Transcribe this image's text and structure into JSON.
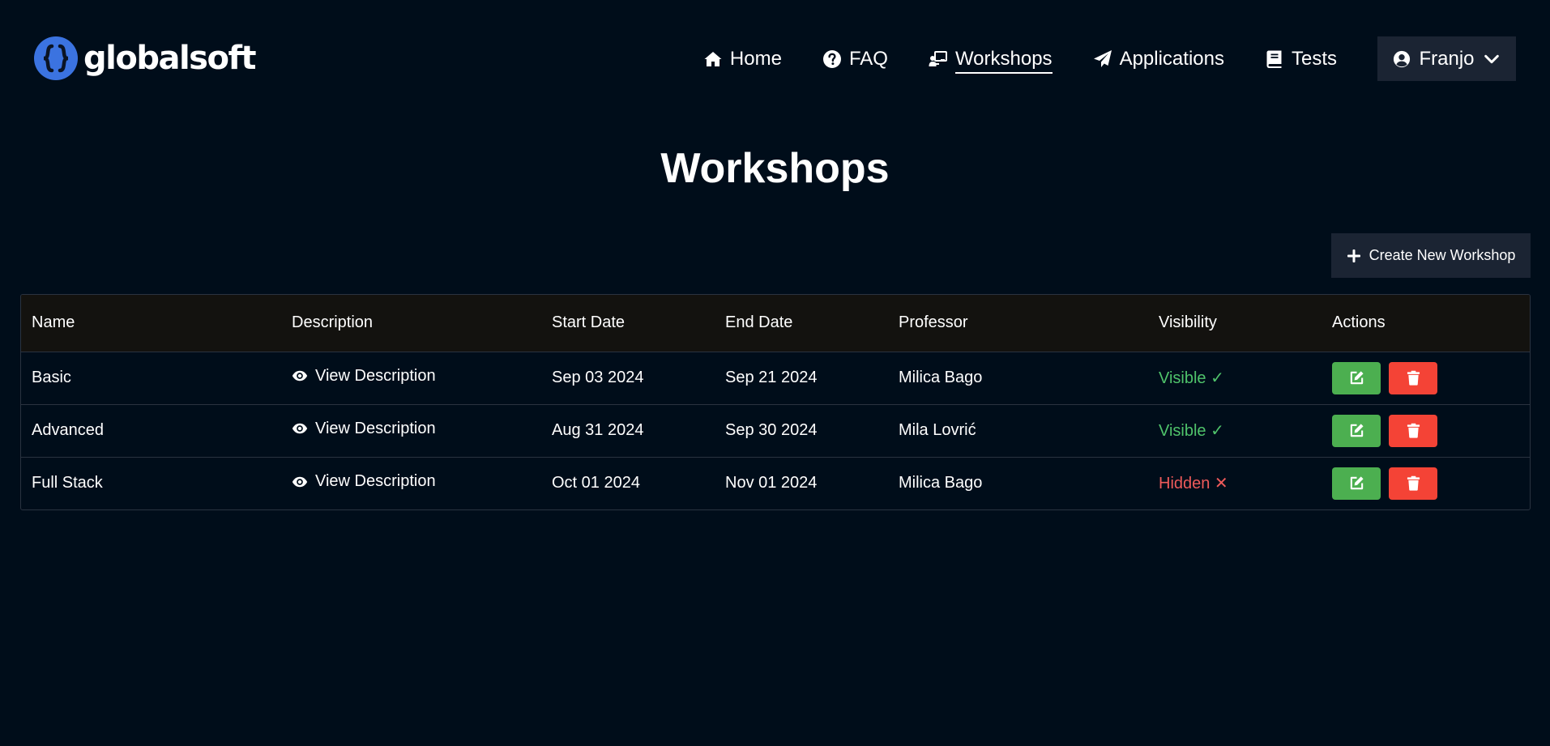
{
  "brand": {
    "name": "globalsoft",
    "logo_color": "#3b73e0"
  },
  "nav": {
    "items": [
      {
        "label": "Home",
        "icon": "home-icon"
      },
      {
        "label": "FAQ",
        "icon": "question-circle-icon"
      },
      {
        "label": "Workshops",
        "icon": "chalkboard-teacher-icon",
        "active": true
      },
      {
        "label": "Applications",
        "icon": "paper-plane-icon"
      },
      {
        "label": "Tests",
        "icon": "book-icon"
      }
    ],
    "user": {
      "name": "Franjo",
      "icon": "user-circle-icon"
    }
  },
  "page": {
    "title": "Workshops",
    "create_button_label": "Create New Workshop"
  },
  "table": {
    "columns": [
      "Name",
      "Description",
      "Start Date",
      "End Date",
      "Professor",
      "Visibility",
      "Actions"
    ],
    "rows": [
      {
        "name": "Basic",
        "description": "View Description",
        "start": "Sep 03 2024",
        "end": "Sep 21 2024",
        "professor": "Milica Bago",
        "visibility": "Visible ✓",
        "visible": true
      },
      {
        "name": "Advanced",
        "description": "View Description",
        "start": "Aug 31 2024",
        "end": "Sep 30 2024",
        "professor": "Mila Lovrić",
        "visibility": "Visible ✓",
        "visible": true
      },
      {
        "name": "Full Stack",
        "description": "View Description",
        "start": "Oct 01 2024",
        "end": "Nov 01 2024",
        "professor": "Milica Bago",
        "visibility": "Hidden ✕",
        "visible": false
      }
    ]
  },
  "colors": {
    "background": "#000d1a",
    "header_row": "#13120f",
    "button_dark": "#1b2433",
    "visible": "#4fc36b",
    "hidden": "#ef5a5a",
    "edit": "#4caf50",
    "delete": "#f44336"
  }
}
